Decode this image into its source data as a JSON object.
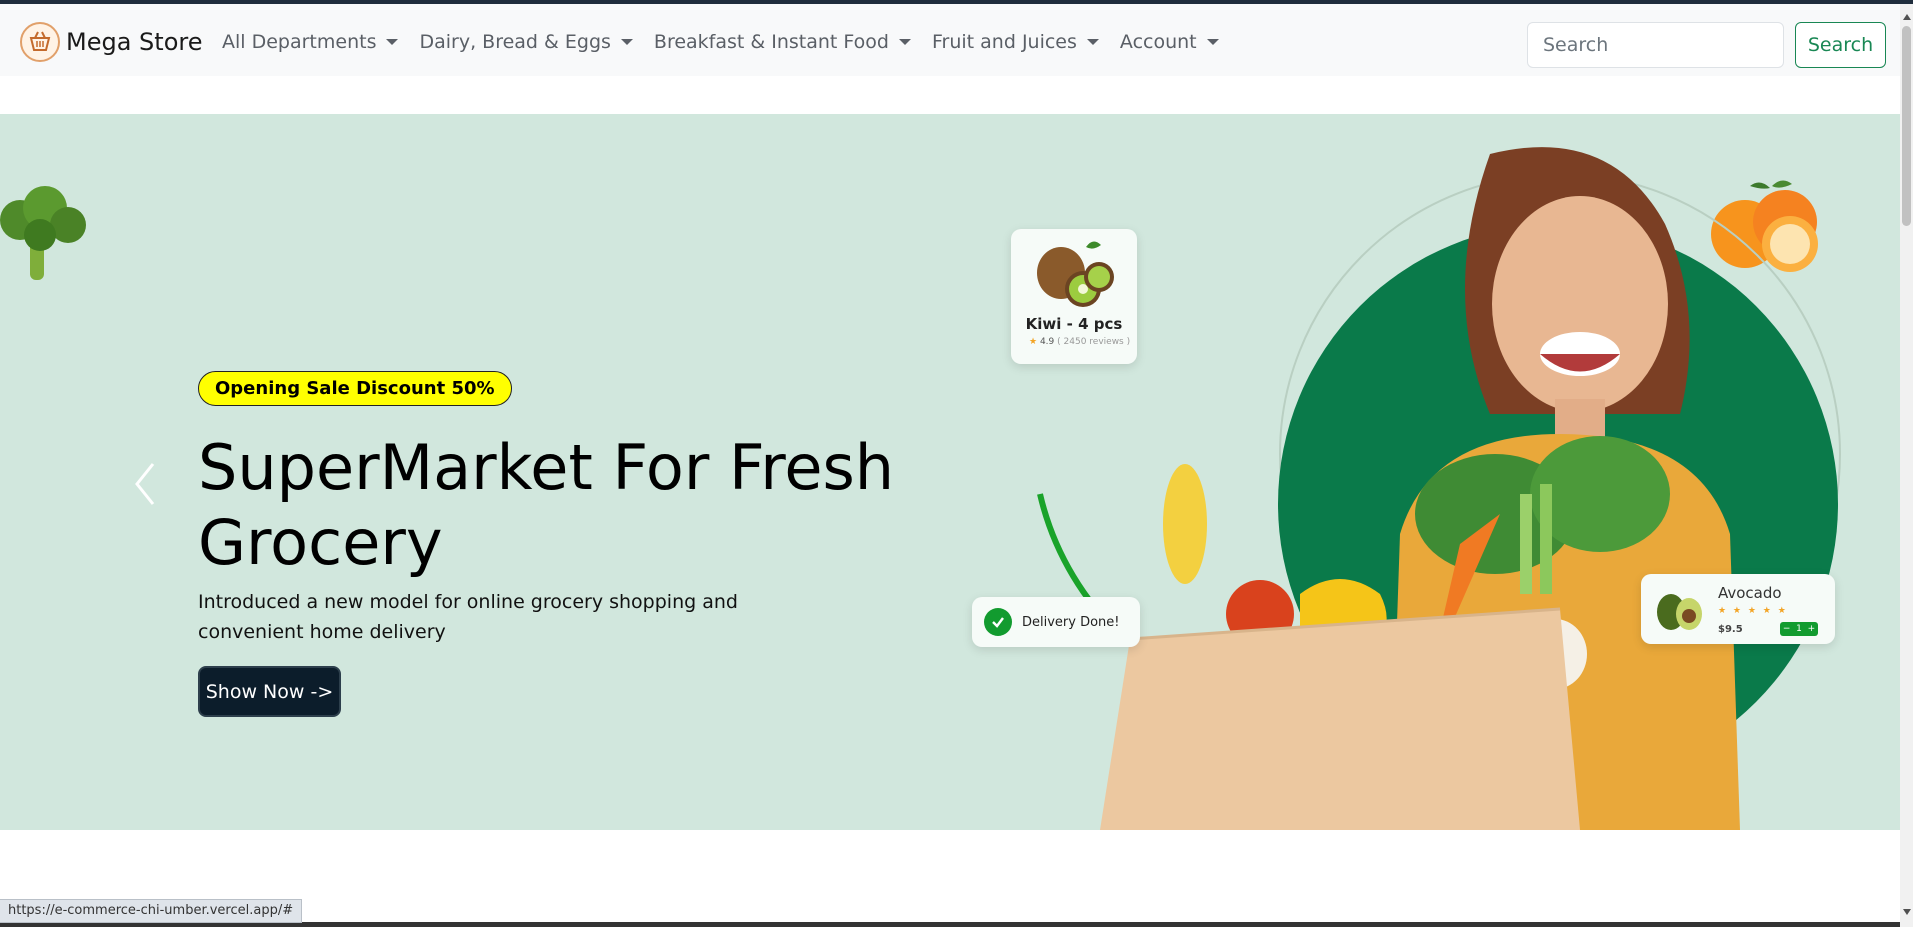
{
  "brand": {
    "name": "Mega Store",
    "logo_icon": "shopping-basket-icon"
  },
  "nav": {
    "items": [
      {
        "label": "All Departments"
      },
      {
        "label": "Dairy, Bread & Eggs"
      },
      {
        "label": "Breakfast & Instant Food"
      },
      {
        "label": "Fruit and Juices"
      },
      {
        "label": "Account"
      }
    ]
  },
  "search": {
    "placeholder": "Search",
    "value": "",
    "button_label": "Search"
  },
  "hero": {
    "badge": "Opening Sale Discount 50%",
    "title": "SuperMarket For Fresh Grocery",
    "subtitle": "Introduced a new model for online grocery shopping and convenient home delivery",
    "button_label": "Show Now ->",
    "prev_icon": "chevron-left-icon",
    "next_icon": "chevron-right-icon",
    "background_color": "#d1e7dd"
  },
  "floating_cards": {
    "kiwi": {
      "name": "Kiwi - 4 pcs",
      "rating": "4.9",
      "reviews": "( 2450 reviews )"
    },
    "delivery": {
      "text": "Delivery Done!"
    },
    "avocado": {
      "name": "Avocado",
      "stars": "★ ★ ★ ★ ★",
      "price": "$9.5",
      "qty": "1"
    }
  },
  "status_bar": {
    "url": "https://e-commerce-chi-umber.vercel.app/#"
  },
  "colors": {
    "accent": "#198754",
    "badge": "#ffff00",
    "button_dark": "#0c1d2b",
    "circle": "#0a7a4a"
  }
}
